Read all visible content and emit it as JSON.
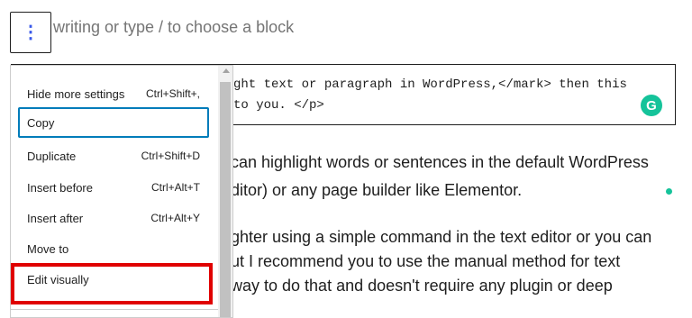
{
  "toolbar": {
    "options_icon": "vertical-ellipsis",
    "options_glyph": "⋮"
  },
  "editor": {
    "placeholder": "writing or type / to choose a block",
    "code_lines": [
      "ght text or paragraph in WordPress,</mark> then this",
      "to you. </p>"
    ],
    "paragraph_lines": [
      "can highlight words or sentences in the default WordPress",
      "ditor) or any page builder like Elementor.",
      "ghter using a simple command in the text editor or you can",
      "ut I recommend you to use the manual method for text",
      " way to do that and doesn't require any plugin or deep"
    ],
    "grammarly_glyph": "G",
    "grammarly_color": "#15c39a"
  },
  "menu": {
    "items": [
      {
        "label": "Hide more settings",
        "shortcut": "Ctrl+Shift+,"
      },
      {
        "label": "Copy",
        "shortcut": ""
      },
      {
        "label": "Duplicate",
        "shortcut": "Ctrl+Shift+D"
      },
      {
        "label": "Insert before",
        "shortcut": "Ctrl+Alt+T"
      },
      {
        "label": "Insert after",
        "shortcut": "Ctrl+Alt+Y"
      },
      {
        "label": "Move to",
        "shortcut": ""
      },
      {
        "label": "Edit visually",
        "shortcut": ""
      }
    ],
    "focus_color": "#007cba",
    "highlight_color": "#e00000"
  }
}
